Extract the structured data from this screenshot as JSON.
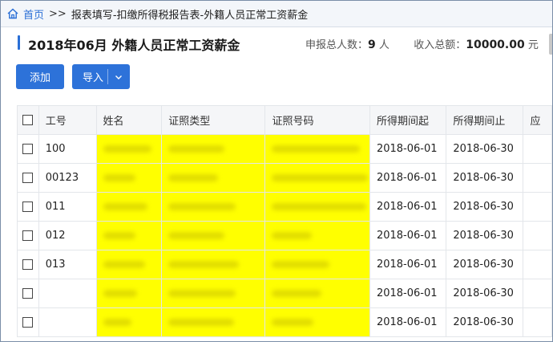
{
  "breadcrumb": {
    "home": "首页",
    "separator": ">>",
    "path": "报表填写-扣缴所得税报告表-外籍人员正常工资薪金"
  },
  "header": {
    "title": "2018年06月 外籍人员正常工资薪金",
    "total_people_label": "申报总人数：",
    "total_people_value": "9",
    "total_people_unit": "人",
    "total_income_label": "收入总额：",
    "total_income_value": "10000.00",
    "total_income_unit": "元"
  },
  "toolbar": {
    "add_label": "添加",
    "import_label": "导入"
  },
  "table": {
    "columns": [
      "工号",
      "姓名",
      "证照类型",
      "证照号码",
      "所得期间起",
      "所得期间止",
      "应"
    ],
    "rows": [
      {
        "id": "100",
        "start": "2018-06-01",
        "end": "2018-06-30"
      },
      {
        "id": "00123",
        "start": "2018-06-01",
        "end": "2018-06-30"
      },
      {
        "id": "011",
        "start": "2018-06-01",
        "end": "2018-06-30"
      },
      {
        "id": "012",
        "start": "2018-06-01",
        "end": "2018-06-30"
      },
      {
        "id": "013",
        "start": "2018-06-01",
        "end": "2018-06-30"
      },
      {
        "id": "",
        "start": "2018-06-01",
        "end": "2018-06-30"
      },
      {
        "id": "",
        "start": "2018-06-01",
        "end": "2018-06-30"
      }
    ]
  },
  "colors": {
    "accent": "#2d72d9",
    "redaction": "#ffff00"
  },
  "icons": {
    "home": "home-icon",
    "dropdown": "chevron-down-icon",
    "checkbox": "checkbox-icon"
  }
}
